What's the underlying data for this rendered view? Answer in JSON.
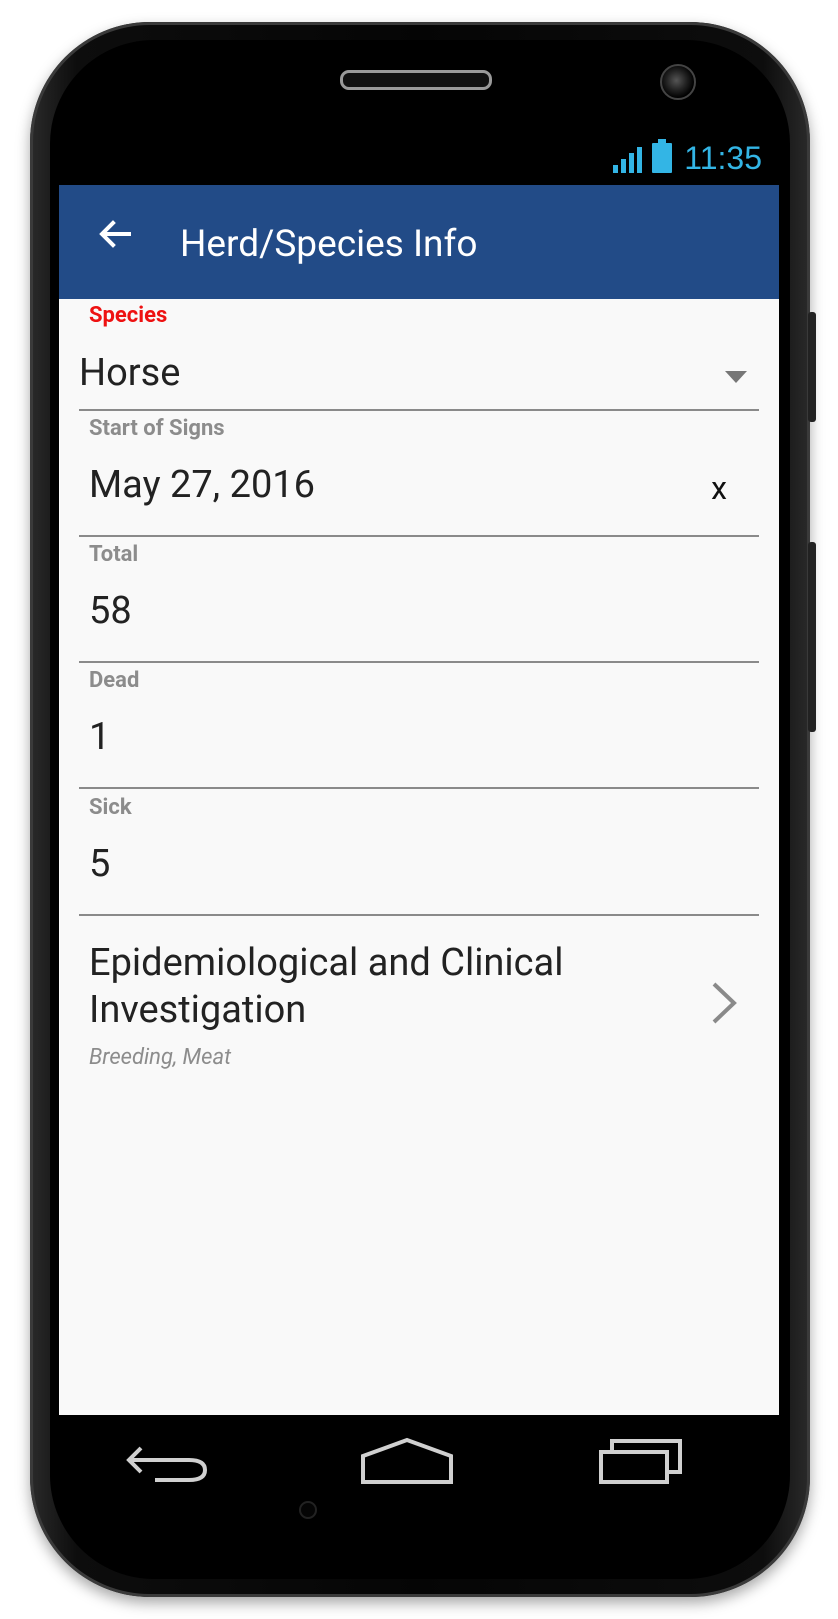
{
  "status_bar": {
    "time": "11:35",
    "accent_color": "#33b5e5",
    "icons": [
      "signal-icon",
      "battery-icon"
    ]
  },
  "app_bar": {
    "title": "Herd/Species Info",
    "back_icon": "arrow-back-icon",
    "color": "#224b87"
  },
  "form": {
    "species": {
      "label": "Species",
      "value": "Horse"
    },
    "start_of_signs": {
      "label": "Start of Signs",
      "value": "May 27, 2016",
      "clear": "x"
    },
    "total": {
      "label": "Total",
      "value": "58"
    },
    "dead": {
      "label": "Dead",
      "value": "1"
    },
    "sick": {
      "label": "Sick",
      "value": "5"
    }
  },
  "epi": {
    "title": "Epidemiological and Clinical Investigation",
    "subtitle": "Breeding, Meat"
  },
  "nav_bar": {
    "icons": [
      "back-nav-icon",
      "home-nav-icon",
      "recents-nav-icon"
    ]
  }
}
